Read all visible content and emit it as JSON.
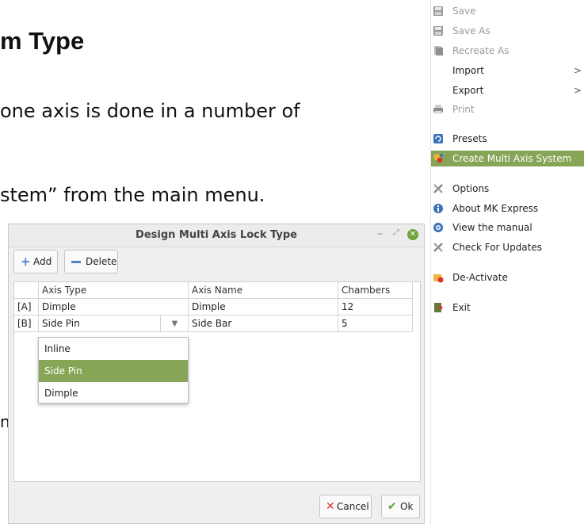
{
  "document": {
    "title_fragment": "m Type",
    "line1_fragment": "one axis is done in a number of",
    "line2_fragment": "stem” from the main menu.",
    "left_fragment": "n"
  },
  "menu": {
    "items": [
      {
        "label": "Save",
        "icon": "save-icon",
        "disabled": true
      },
      {
        "label": "Save As",
        "icon": "save-icon",
        "disabled": true
      },
      {
        "label": "Recreate As",
        "icon": "recreate-icon",
        "disabled": true
      },
      {
        "label": "Import",
        "icon": "",
        "submenu": true
      },
      {
        "label": "Export",
        "icon": "",
        "submenu": true
      },
      {
        "label": "Print",
        "icon": "print-icon",
        "disabled": true
      },
      {
        "label": "Presets",
        "icon": "presets-icon"
      },
      {
        "label": "Create Multi Axis System",
        "icon": "multi-axis-icon",
        "highlighted": true
      },
      {
        "label": "Options",
        "icon": "tools-icon"
      },
      {
        "label": "About MK Express",
        "icon": "info-icon"
      },
      {
        "label": "View the manual",
        "icon": "help-icon"
      },
      {
        "label": "Check For Updates",
        "icon": "tools-icon"
      },
      {
        "label": "De-Activate",
        "icon": "deactivate-icon"
      },
      {
        "label": "Exit",
        "icon": "exit-icon"
      }
    ],
    "submenu_arrow": ">"
  },
  "dialog": {
    "title": "Design Multi Axis Lock Type",
    "controls": {
      "minimize": "–",
      "maximize": "⤢",
      "close": "✕"
    },
    "toolbar": {
      "add_label": "Add",
      "delete_label": "Delete"
    },
    "table": {
      "headers": [
        "",
        "Axis Type",
        "Axis Name",
        "Chambers"
      ],
      "rows": [
        {
          "id": "[A]",
          "axis_type": "Dimple",
          "axis_name": "Dimple",
          "chambers": "12"
        },
        {
          "id": "[B]",
          "axis_type": "Side Pin",
          "axis_name": "Side Bar",
          "chambers": "5"
        }
      ]
    },
    "dropdown": {
      "options": [
        "Inline",
        "Side Pin",
        "Dimple"
      ],
      "selected": "Side Pin"
    },
    "buttons": {
      "cancel_label": "Cancel",
      "ok_label": "Ok"
    }
  },
  "colors": {
    "highlight": "#87a556",
    "close_button": "#71a33b",
    "add_icon": "#4e7fc9",
    "cancel_icon": "#d9352c",
    "ok_icon": "#5f9e2a"
  }
}
